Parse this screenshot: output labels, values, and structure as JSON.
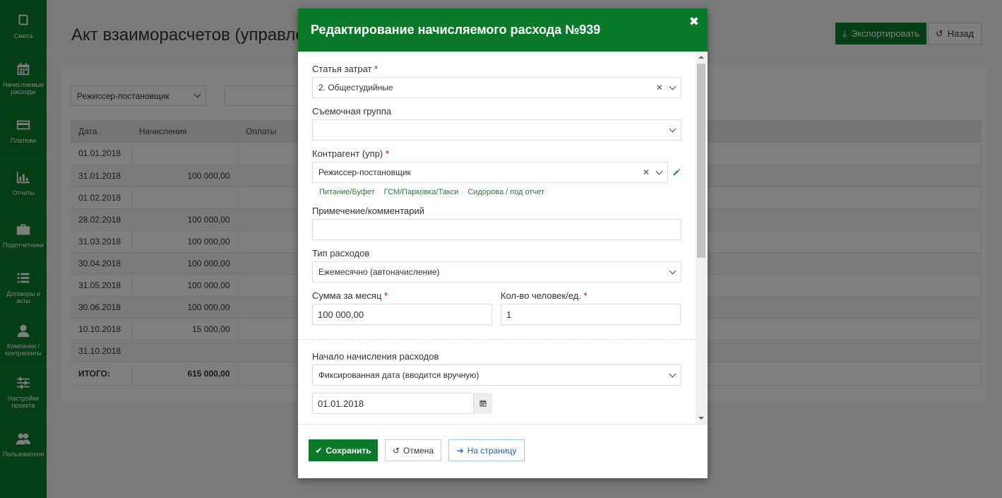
{
  "sidebar": {
    "items": [
      {
        "icon": "book-icon",
        "label": "Смета"
      },
      {
        "icon": "calendar-icon",
        "label": "Начисляемые расходы"
      },
      {
        "icon": "card-icon",
        "label": "Платежи"
      },
      {
        "icon": "bar-chart-icon",
        "label": "Отчеты"
      },
      {
        "icon": "briefcase-icon",
        "label": "Подотчетники"
      },
      {
        "icon": "list-icon",
        "label": "Договоры и акты"
      },
      {
        "icon": "user-icon",
        "label": "Компании / контрагенты"
      },
      {
        "icon": "sliders-icon",
        "label": "Настройки проекта"
      },
      {
        "icon": "users-icon",
        "label": "Пользователи"
      }
    ]
  },
  "page": {
    "title": "Акт взаиморасчетов (управленческий)",
    "export_label": "Экспортировать",
    "back_label": "Назад",
    "filter_value": "Режиссер-постановщик",
    "table": {
      "headers": [
        "Дата",
        "Начисления",
        "Оплаты"
      ],
      "rows": [
        {
          "date": "01.01.2018",
          "accrual": ""
        },
        {
          "date": "31.01.2018",
          "accrual": "100 000,00"
        },
        {
          "date": "01.02.2018",
          "accrual": ""
        },
        {
          "date": "28.02.2018",
          "accrual": "100 000,00"
        },
        {
          "date": "31.03.2018",
          "accrual": "100 000,00"
        },
        {
          "date": "30.04.2018",
          "accrual": "100 000,00"
        },
        {
          "date": "31.05.2018",
          "accrual": "100 000,00"
        },
        {
          "date": "30.06.2018",
          "accrual": "100 000,00"
        },
        {
          "date": "10.10.2018",
          "accrual": "15 000,00"
        },
        {
          "date": "31.10.2018",
          "accrual": ""
        }
      ],
      "total_label": "ИТОГО:",
      "total_value": "615 000,00"
    }
  },
  "modal": {
    "title": "Редактирование начисляемого расхода №939",
    "cost_item": {
      "label": "Статья затрат",
      "value": "2. Общестудийные"
    },
    "crew": {
      "label": "Съемочная группа",
      "value": ""
    },
    "counterparty": {
      "label": "Контрагент (упр)",
      "value": "Режиссер-постановщик"
    },
    "quick_links": [
      "Питание/Буфет",
      "ГСМ/Парковка/Такси",
      "Сидорова / под отчет"
    ],
    "comment": {
      "label": "Примечение/комментарий",
      "value": ""
    },
    "expense_type": {
      "label": "Тип расходов",
      "value": "Ежемесячно (автоначисление)"
    },
    "monthly_sum": {
      "label": "Сумма за месяц",
      "value": "100 000,00"
    },
    "quantity": {
      "label": "Кол-во человек/ед.",
      "value": "1"
    },
    "start": {
      "label": "Начало начисления расходов",
      "value": "Фиксированная дата (вводится вручную)"
    },
    "start_date": {
      "value": "01.01.2018"
    },
    "buttons": {
      "save": "Сохранить",
      "cancel": "Отмена",
      "to_page": "На страницу"
    }
  }
}
